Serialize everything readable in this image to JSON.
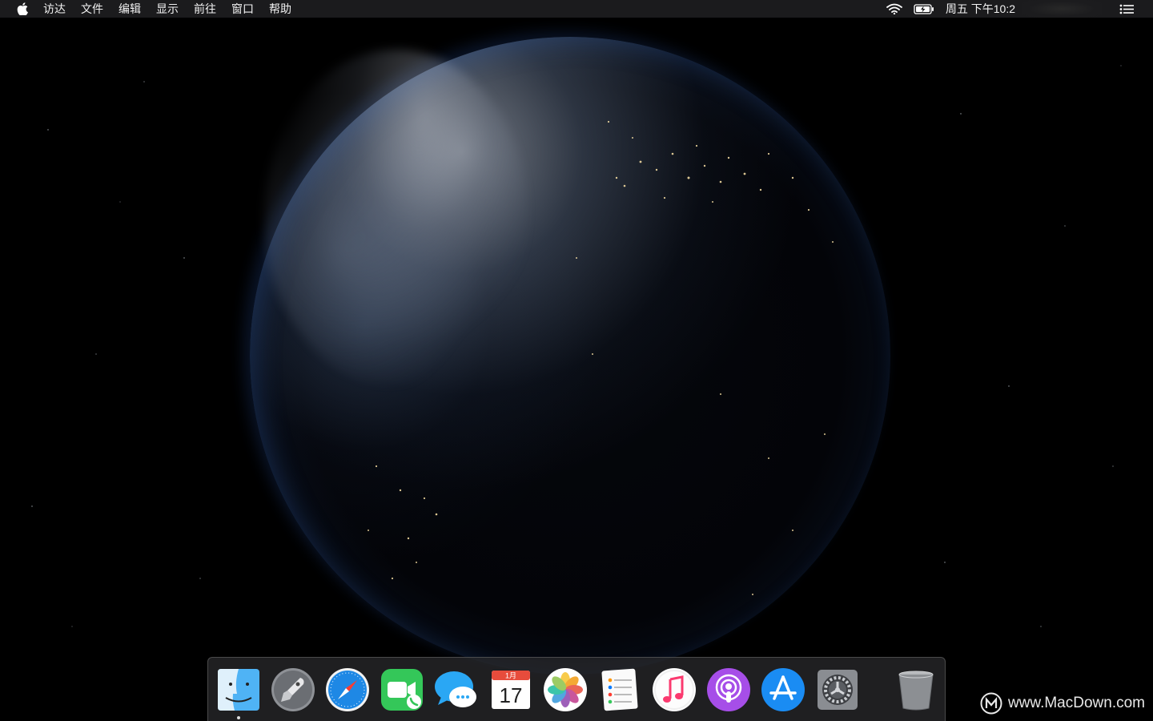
{
  "menubar": {
    "apple_icon": "apple-logo-icon",
    "items": [
      "访达",
      "文件",
      "编辑",
      "显示",
      "前往",
      "窗口",
      "帮助"
    ],
    "status_icons": [
      "wifi-icon",
      "battery-charging-icon"
    ],
    "clock": "周五 下午10:2",
    "control_icon": "notification-center-icon"
  },
  "wallpaper": {
    "description_icon": "earth-night-wallpaper"
  },
  "dock": {
    "apps": [
      {
        "name": "finder",
        "icon": "finder-icon",
        "running": true
      },
      {
        "name": "launchpad",
        "icon": "launchpad-rocket-icon",
        "running": false
      },
      {
        "name": "safari",
        "icon": "safari-compass-icon",
        "running": false
      },
      {
        "name": "facetime",
        "icon": "facetime-icon",
        "running": false
      },
      {
        "name": "messages",
        "icon": "messages-icon",
        "running": false
      },
      {
        "name": "calendar",
        "icon": "calendar-icon",
        "running": false
      },
      {
        "name": "photos",
        "icon": "photos-icon",
        "running": false
      },
      {
        "name": "reminders",
        "icon": "reminders-icon",
        "running": false
      },
      {
        "name": "itunes",
        "icon": "music-note-icon",
        "running": false
      },
      {
        "name": "podcasts",
        "icon": "podcasts-icon",
        "running": false
      },
      {
        "name": "app-store",
        "icon": "app-store-icon",
        "running": false
      },
      {
        "name": "system-preferences",
        "icon": "gear-icon",
        "running": false
      }
    ],
    "calendar_month": "1月",
    "calendar_day": "17",
    "trash": {
      "icon": "trash-icon"
    }
  },
  "watermark": {
    "text": "www.MacDown.com",
    "logo_letter": "M"
  }
}
